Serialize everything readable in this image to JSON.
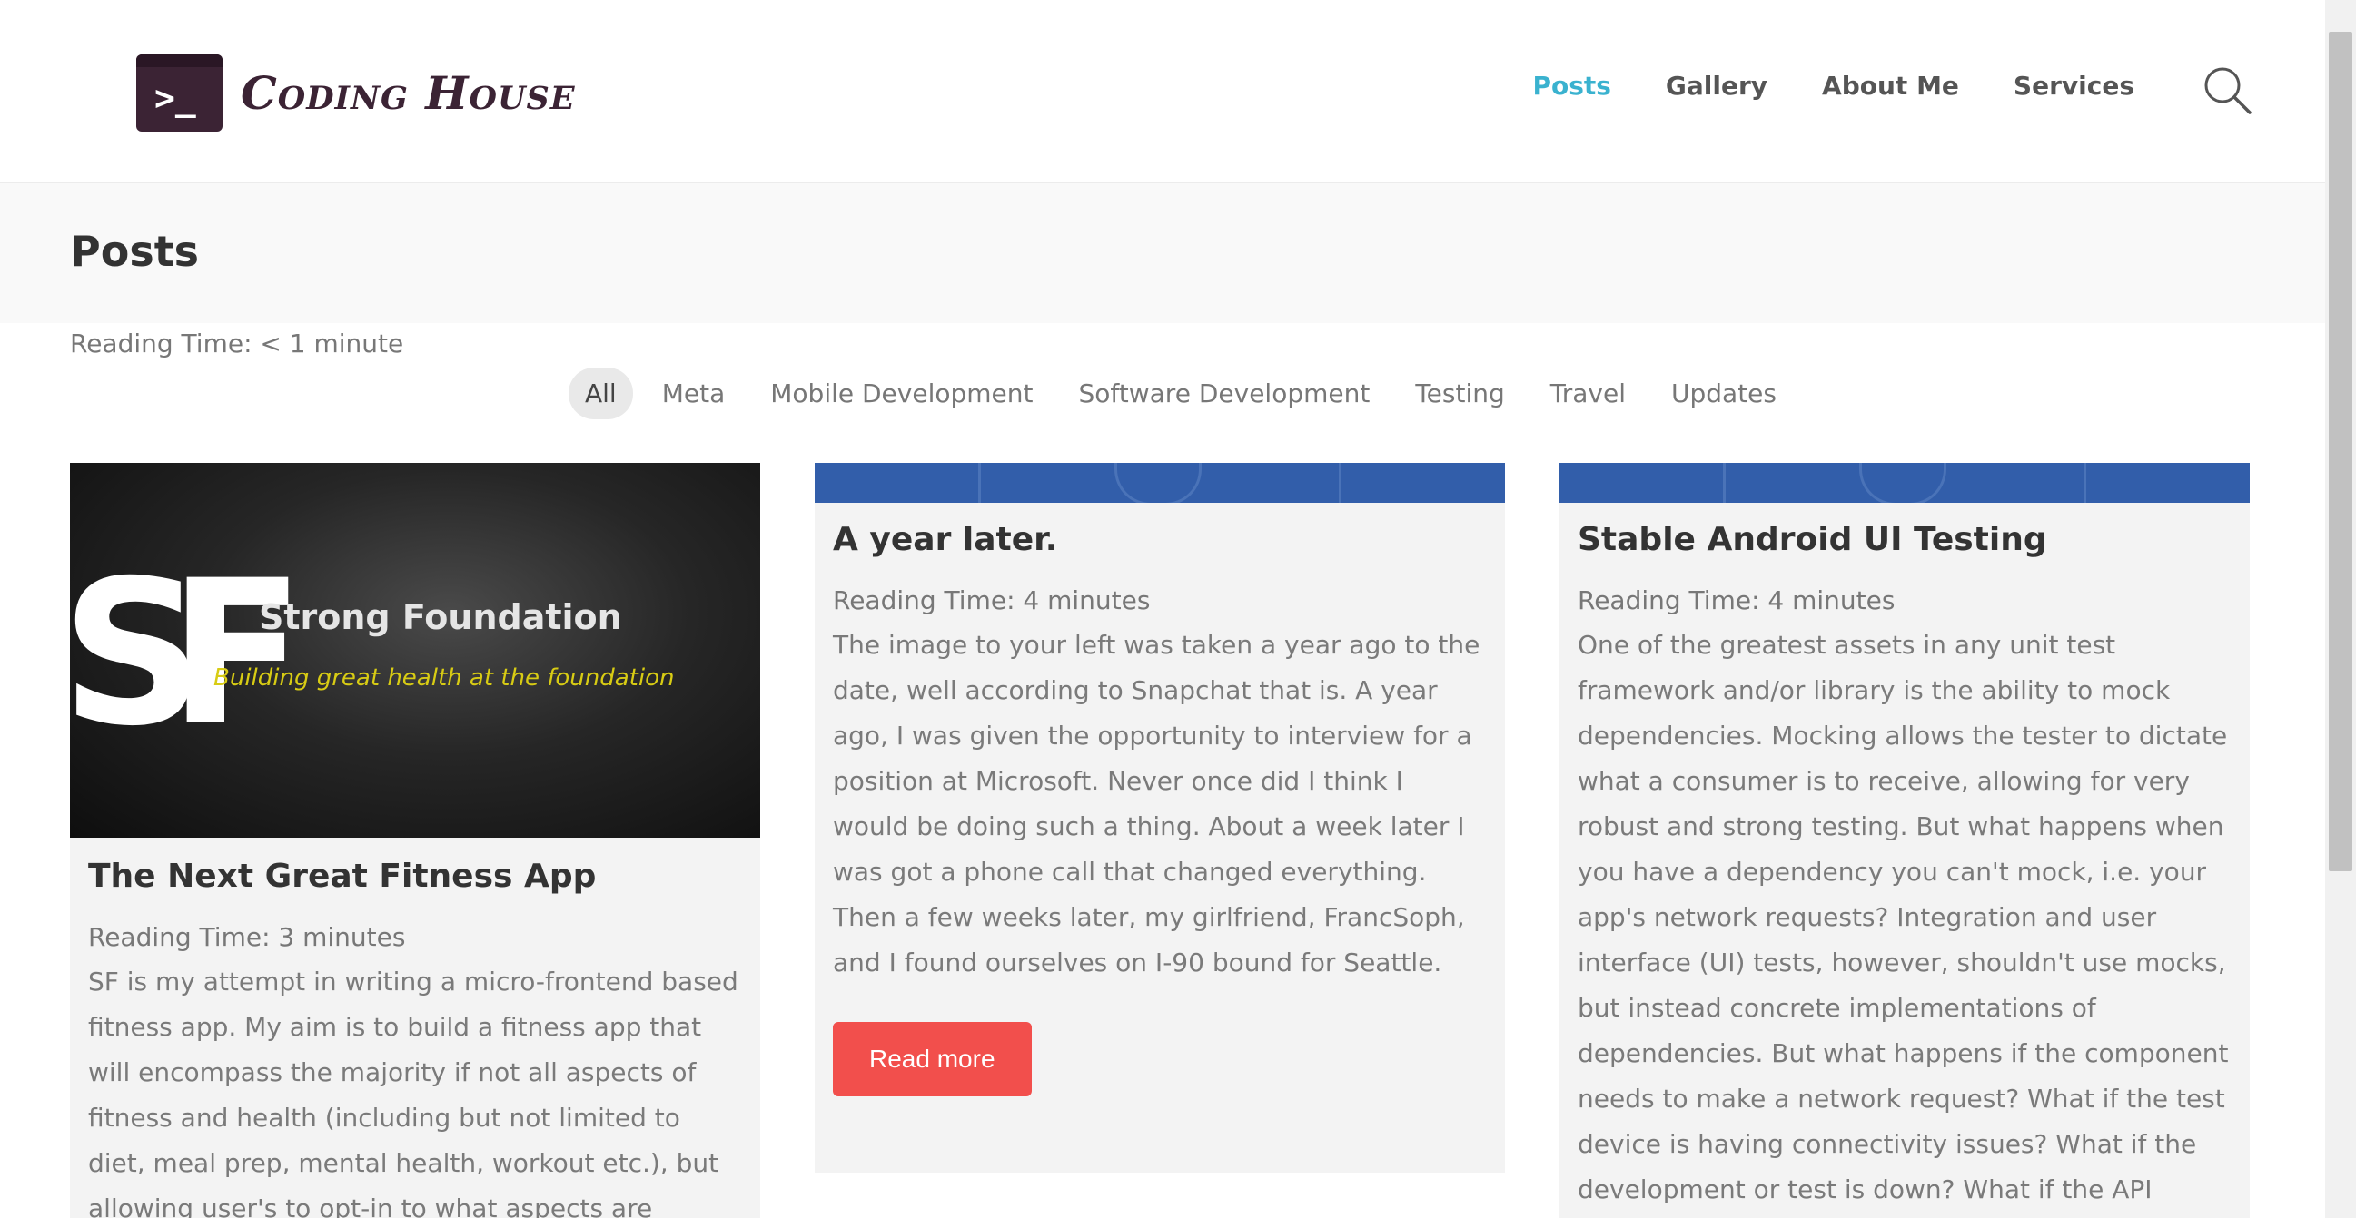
{
  "brand": {
    "name": "Coding House",
    "prompt": ">_"
  },
  "nav": [
    {
      "label": "Posts",
      "active": true
    },
    {
      "label": "Gallery",
      "active": false
    },
    {
      "label": "About Me",
      "active": false
    },
    {
      "label": "Services",
      "active": false
    }
  ],
  "page": {
    "title": "Posts",
    "reading_time": "Reading Time: < 1 minute"
  },
  "filters": [
    "All",
    "Meta",
    "Mobile Development",
    "Software Development",
    "Testing",
    "Travel",
    "Updates"
  ],
  "posts": [
    {
      "image_title": "Strong Foundation",
      "image_subtitle": "Building great health at the foundation",
      "image_letters": "SF",
      "title": "The Next Great Fitness App",
      "reading_time": "Reading Time: 3 minutes",
      "excerpt": "SF is my attempt in writing a micro-frontend based fitness app. My aim is to build a fitness app that will encompass the majority if not all aspects of fitness and health (including but not limited to diet, meal prep, mental health, workout etc.), but allowing user's to opt-in to what aspects are important to them, willingly and"
    },
    {
      "title": "A year later.",
      "reading_time": "Reading Time: 4 minutes",
      "excerpt": "The image to your left was taken a year ago to the date, well according to Snapchat that is. A year ago, I was given the opportunity to interview for a position at Microsoft. Never once did I think I would be doing such a thing. About a week later I was got a phone call that changed everything. Then a few weeks later, my girlfriend, FrancSoph, and I found ourselves on I-90 bound for Seattle.",
      "button": "Read more"
    },
    {
      "title": "Stable Android UI Testing",
      "reading_time": "Reading Time: 4 minutes",
      "excerpt": "One of the greatest assets in any unit test framework and/or library is the ability to mock dependencies. Mocking allows the tester to dictate what a consumer is to receive, allowing for very robust and strong testing. But what happens when you have a dependency you can't mock, i.e. your app's network requests? Integration and user interface (UI) tests, however, shouldn't use mocks, but instead concrete implementations of dependencies. But what happens if the component needs to make a network request? What if the test device is having connectivity issues? What if the development or test is down? What if the API functionality just hasn't been written yet?"
    }
  ],
  "colors": {
    "accent": "#3ab2cf",
    "button": "#f24f4c",
    "brand": "#3b2334",
    "thumb_blue": "#325eaa"
  },
  "icons": {
    "search": "search-icon"
  }
}
